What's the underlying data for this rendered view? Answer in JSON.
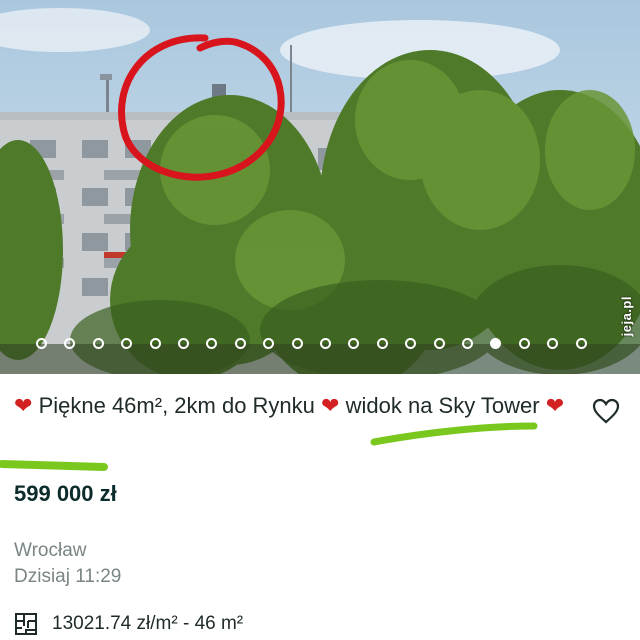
{
  "listing": {
    "title_part1": "Piękne 46m², 2km do Rynku",
    "title_part2": "widok na Sky Tower",
    "price": "599 000 zł",
    "location": "Wrocław",
    "date": "Dzisiaj 11:29",
    "area_info": "13021.74 zł/m² - 46 m²"
  },
  "gallery": {
    "total_images": 20,
    "active_index": 16,
    "watermark": "jeja.pl"
  },
  "icons": {
    "favorite": "heart-outline-icon",
    "area": "floor-plan-icon",
    "title_emoji": "red-heart-icon"
  },
  "colors": {
    "price_text": "#0c2b2b",
    "muted_text": "#7a8585",
    "annotation_circle": "#d8141c",
    "annotation_underline": "#7ac81e",
    "heart_emoji": "#d32020"
  }
}
